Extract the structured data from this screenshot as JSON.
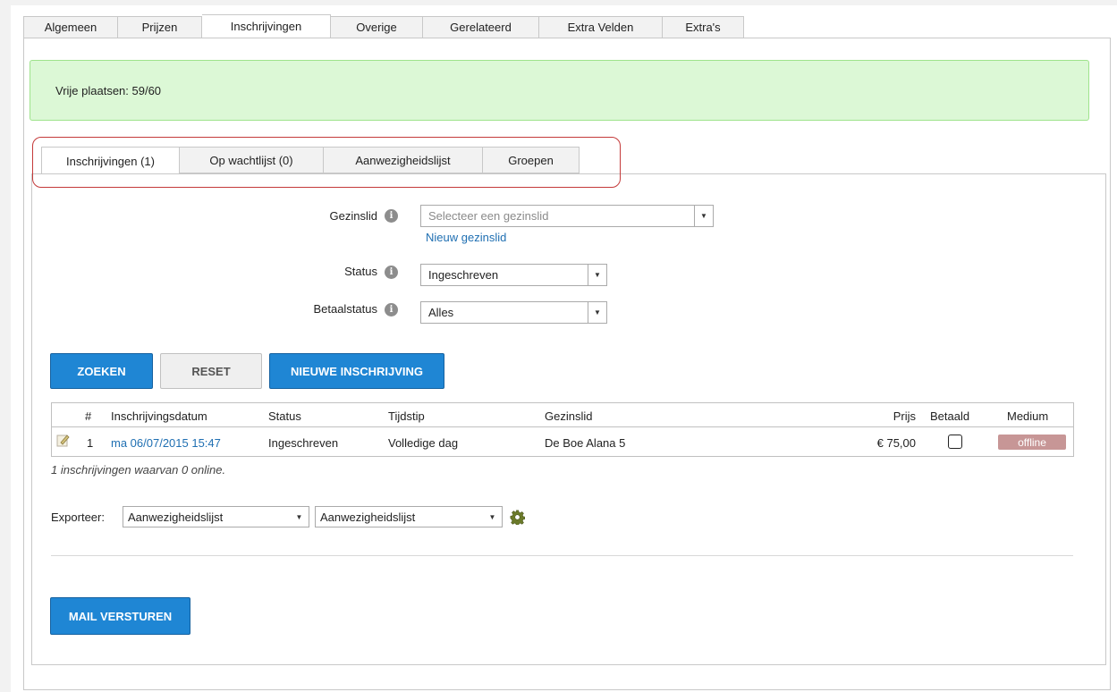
{
  "top_tabs": [
    {
      "label": "Algemeen"
    },
    {
      "label": "Prijzen"
    },
    {
      "label": "Inschrijvingen"
    },
    {
      "label": "Overige"
    },
    {
      "label": "Gerelateerd"
    },
    {
      "label": "Extra Velden"
    },
    {
      "label": "Extra's"
    }
  ],
  "active_top_tab": "Inschrijvingen",
  "alert": {
    "text": "Vrije plaatsen: 59/60"
  },
  "sub_tabs": [
    {
      "label": "Inschrijvingen (1)"
    },
    {
      "label": "Op wachtlijst (0)"
    },
    {
      "label": "Aanwezigheidslijst"
    },
    {
      "label": "Groepen"
    }
  ],
  "active_sub_tab": "Inschrijvingen (1)",
  "filters": {
    "gezinslid": {
      "label": "Gezinslid",
      "placeholder": "Selecteer een gezinslid",
      "new_link": "Nieuw gezinslid"
    },
    "status": {
      "label": "Status",
      "value": "Ingeschreven"
    },
    "betaalstatus": {
      "label": "Betaalstatus",
      "value": "Alles"
    }
  },
  "buttons": {
    "search": "ZOEKEN",
    "reset": "RESET",
    "new_registration": "NIEUWE INSCHRIJVING",
    "send_mail": "MAIL VERSTUREN"
  },
  "table": {
    "headers": {
      "nr": "#",
      "date": "Inschrijvingsdatum",
      "status": "Status",
      "time": "Tijdstip",
      "member": "Gezinslid",
      "price": "Prijs",
      "paid": "Betaald",
      "medium": "Medium"
    },
    "rows": [
      {
        "nr": "1",
        "date": "ma 06/07/2015 15:47",
        "status": "Ingeschreven",
        "time": "Volledige dag",
        "member": "De Boe Alana 5",
        "price": "€ 75,00",
        "paid": false,
        "medium": "offline"
      }
    ]
  },
  "summary": "1 inschrijvingen waarvan 0 online.",
  "export": {
    "label": "Exporteer:",
    "format1": "Aanwezigheidslijst",
    "format2": "Aanwezigheidslijst"
  },
  "colors": {
    "accent_blue": "#1f86d4",
    "alert_green": "#dcf8d6",
    "highlight_red": "#c43a3a",
    "offline_badge": "#c79696"
  }
}
